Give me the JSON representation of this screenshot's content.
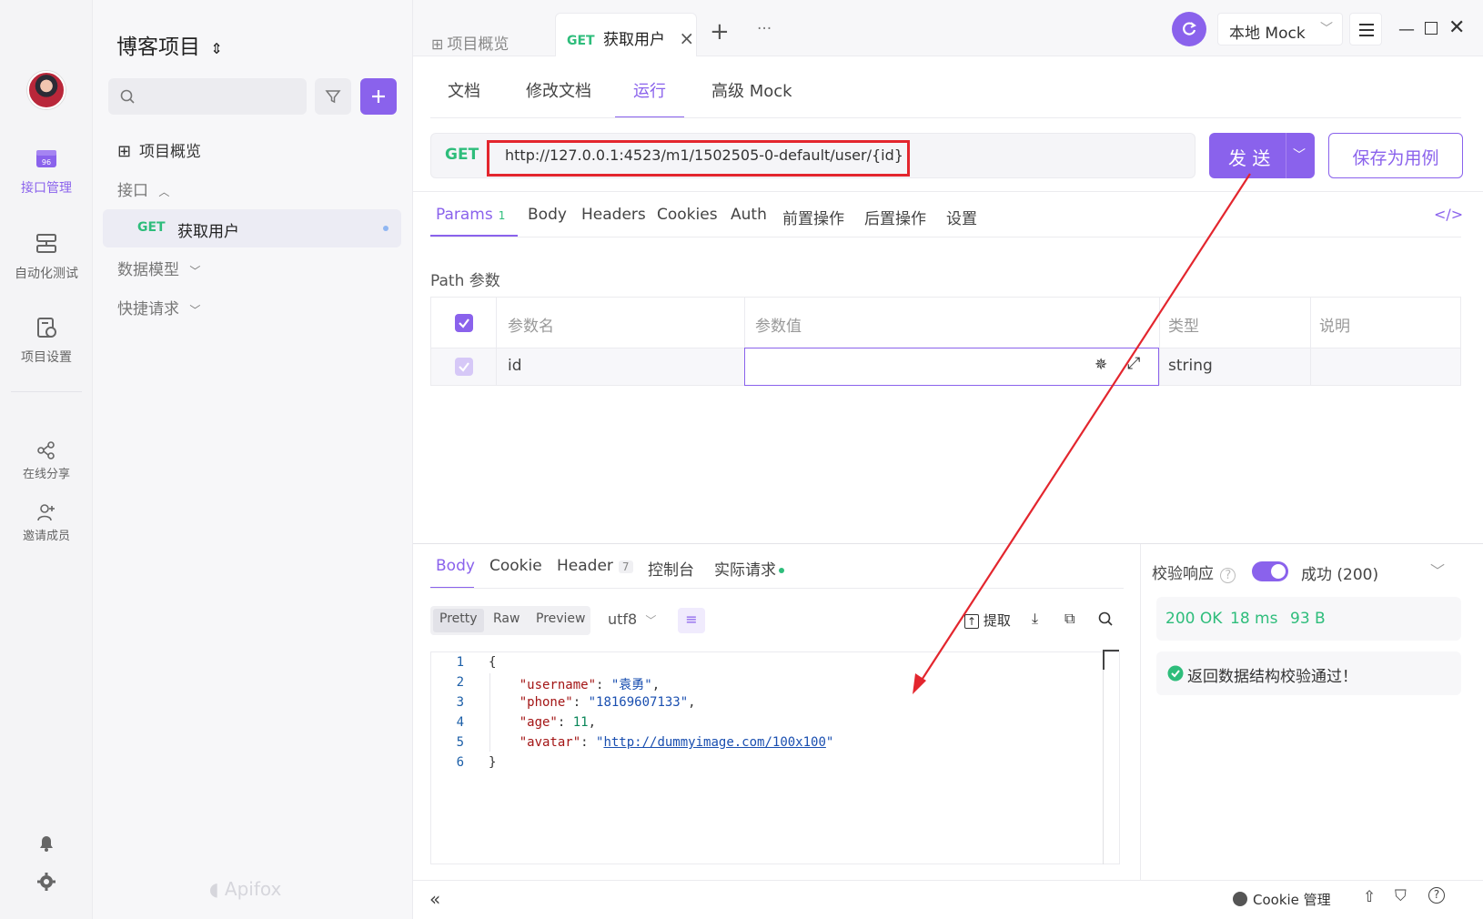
{
  "rail": {
    "items": [
      {
        "label": "接口管理"
      },
      {
        "label": "自动化测试"
      },
      {
        "label": "项目设置"
      },
      {
        "label": "在线分享"
      },
      {
        "label": "邀请成员"
      }
    ]
  },
  "sidebar": {
    "project_title": "博客项目",
    "overview_label": "项目概览",
    "interfaces_label": "接口",
    "tree_method": "GET",
    "tree_item": "获取用户",
    "data_models_label": "数据模型",
    "quick_requests_label": "快捷请求",
    "brand": "Apifox"
  },
  "tabs": {
    "overview": "项目概览",
    "active_method": "GET",
    "active_label": "获取用户",
    "add": "+",
    "more": "···"
  },
  "env": {
    "label": "本地 Mock"
  },
  "subtabs": {
    "doc": "文档",
    "edit": "修改文档",
    "run": "运行",
    "mock": "高级 Mock"
  },
  "request": {
    "method": "GET",
    "url": "http://127.0.0.1:4523/m1/1502505-0-default/user/{id}",
    "send": "发 送",
    "save": "保存为用例"
  },
  "params_tabs": {
    "params": "Params",
    "params_count": "1",
    "body": "Body",
    "headers": "Headers",
    "cookies": "Cookies",
    "auth": "Auth",
    "pre": "前置操作",
    "post": "后置操作",
    "settings": "设置"
  },
  "path_params": {
    "section_title": "Path 参数",
    "headers": [
      "参数名",
      "参数值",
      "类型",
      "说明"
    ],
    "rows": [
      {
        "name": "id",
        "value": "",
        "type": "string",
        "desc": ""
      }
    ]
  },
  "response_tabs": {
    "body": "Body",
    "cookie": "Cookie",
    "header": "Header",
    "header_count": "7",
    "console": "控制台",
    "actual": "实际请求"
  },
  "response_view": {
    "pretty": "Pretty",
    "raw": "Raw",
    "preview": "Preview",
    "encoding": "utf8",
    "extract": "提取"
  },
  "response_body": {
    "line_numbers": [
      "1",
      "2",
      "3",
      "4",
      "5",
      "6"
    ],
    "username": "\"袁勇\"",
    "phone": "\"18169607133\"",
    "age": "11",
    "avatar": "http://dummyimage.com/100x100"
  },
  "validation": {
    "label": "校验响应",
    "result": "成功 (200)",
    "status": "200 OK",
    "time": "18 ms",
    "size": "93 B",
    "message": "返回数据结构校验通过！"
  },
  "statusbar": {
    "cookie_manage": "Cookie 管理"
  },
  "colors": {
    "accent": "#8a62ec",
    "get": "#2ebd7b",
    "highlight": "#e3262e"
  }
}
